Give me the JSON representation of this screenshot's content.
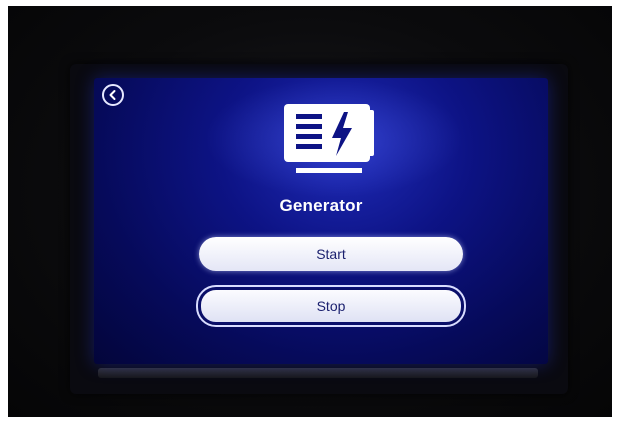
{
  "screen": {
    "title": "Generator",
    "back_icon": "chevron-left-icon",
    "device_icon": "generator-icon",
    "buttons": {
      "start_label": "Start",
      "stop_label": "Stop"
    }
  },
  "colors": {
    "screen_background": "#0d1385",
    "button_background": "#ffffff",
    "button_text": "#1a1f6e",
    "title_text": "#ffffff"
  }
}
